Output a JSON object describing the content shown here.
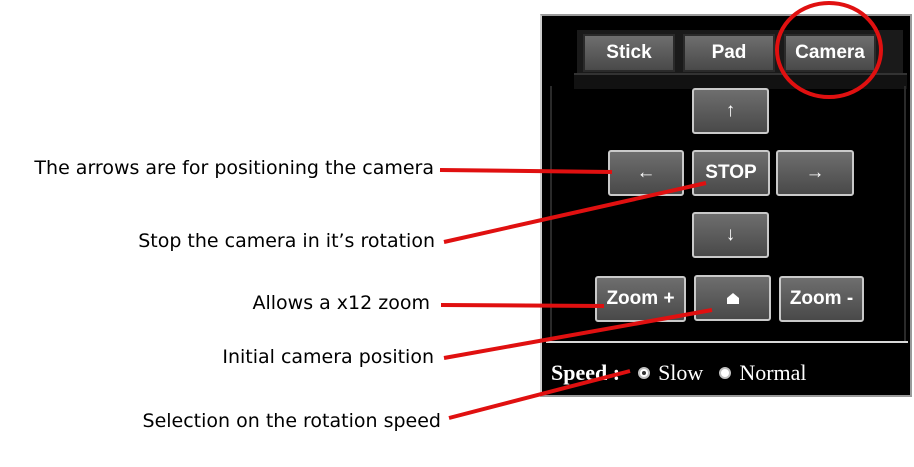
{
  "annotations": {
    "arrows": "The arrows are for positioning the camera",
    "stop": "Stop the camera in it’s rotation",
    "zoom": "Allows a x12 zoom",
    "home": "Initial camera position",
    "speed": "Selection on the rotation speed"
  },
  "tabs": [
    {
      "label": "Stick"
    },
    {
      "label": "Pad"
    },
    {
      "label": "Camera",
      "selected": true
    }
  ],
  "controls": {
    "up": "↑",
    "left": "←",
    "stop": "STOP",
    "right": "→",
    "down": "↓",
    "zoom_in": "Zoom +",
    "home_icon": "home-icon",
    "zoom_out": "Zoom -"
  },
  "speed": {
    "label": "Speed :",
    "options": [
      "Slow",
      "Normal"
    ],
    "selected": "Slow"
  },
  "colors": {
    "annotation_red": "#e01010",
    "panel_bg": "#000000",
    "button_gradient_top": "#6e6e6e",
    "button_gradient_bottom": "#494949"
  }
}
